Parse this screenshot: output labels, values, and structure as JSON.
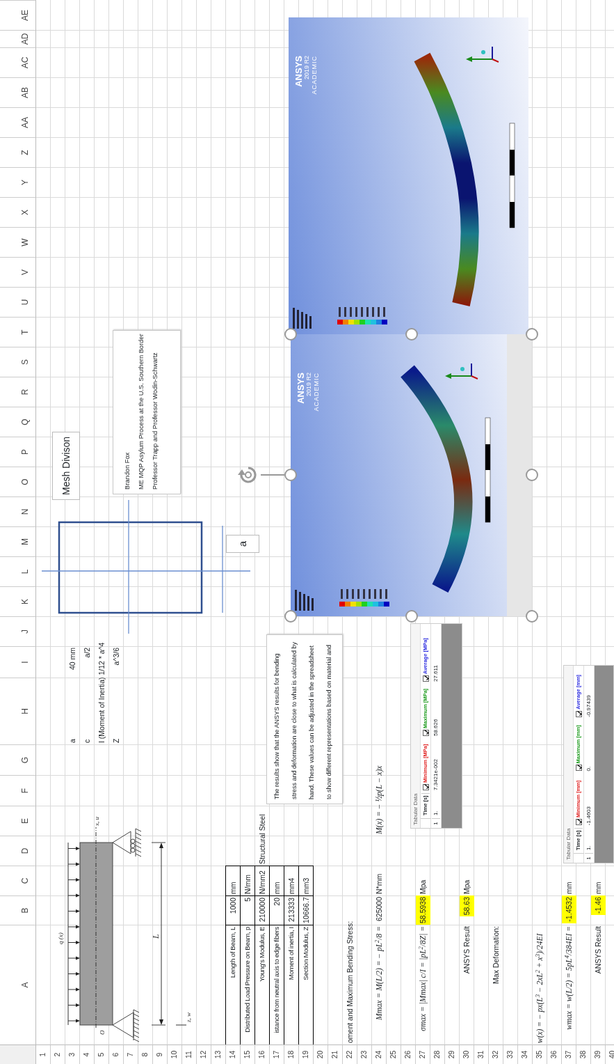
{
  "column_letters": [
    "A",
    "B",
    "C",
    "D",
    "E",
    "F",
    "G",
    "H",
    "I",
    "J",
    "K",
    "L",
    "M",
    "N",
    "O",
    "P",
    "Q",
    "R",
    "S",
    "T",
    "U",
    "V",
    "W",
    "X",
    "Y",
    "Z",
    "AA",
    "AB",
    "AC",
    "AD",
    "AE"
  ],
  "rows": [
    {
      "number": "1"
    },
    {
      "number": "2"
    },
    {
      "number": "3",
      "cells": [
        null,
        null,
        null,
        null,
        null,
        null,
        null,
        {
          "kind": "text",
          "text": "a"
        },
        {
          "kind": "value",
          "text": "40 mm",
          "highlighted": false
        }
      ]
    },
    {
      "number": "4",
      "cells": [
        null,
        null,
        null,
        null,
        null,
        null,
        null,
        {
          "kind": "text",
          "text": "c"
        },
        {
          "kind": "value",
          "text": "a/2",
          "highlighted": false
        }
      ]
    },
    {
      "number": "5",
      "cells": [
        null,
        null,
        null,
        null,
        null,
        null,
        null,
        {
          "kind": "text",
          "text": "I (Moment of Inertia) 1/12 * a^4"
        }
      ]
    },
    {
      "number": "6",
      "cells": [
        null,
        null,
        null,
        null,
        null,
        null,
        null,
        {
          "kind": "text",
          "text": "Z"
        },
        {
          "kind": "value",
          "text": "a^3/6",
          "highlighted": false
        }
      ]
    },
    {
      "number": "7"
    },
    {
      "number": "8"
    },
    {
      "number": "9"
    },
    {
      "number": "10"
    },
    {
      "number": "11"
    },
    {
      "number": "12"
    },
    {
      "number": "13"
    },
    {
      "number": "14",
      "cells": [
        {
          "kind": "table-label",
          "text": "Length of Beam, L"
        },
        {
          "kind": "table-value",
          "text": "1000"
        },
        {
          "kind": "table-unit",
          "text": "mm"
        }
      ]
    },
    {
      "number": "15",
      "cells": [
        {
          "kind": "table-label",
          "text": "Distributed Load Pressure on Beam, p"
        },
        {
          "kind": "table-value",
          "text": "5"
        },
        {
          "kind": "table-unit",
          "text": "N/mm"
        }
      ]
    },
    {
      "number": "16",
      "cells": [
        {
          "kind": "table-label",
          "text": "Young's Modulus, E"
        },
        {
          "kind": "table-value",
          "text": "210000"
        },
        {
          "kind": "table-unit",
          "text": "N/mm2"
        },
        {
          "kind": "text",
          "text": "Structural Steel"
        }
      ]
    },
    {
      "number": "17",
      "cells": [
        {
          "kind": "table-label",
          "text": "istance from neutral axis to edge fibers"
        },
        {
          "kind": "table-value",
          "text": "20"
        },
        {
          "kind": "table-unit",
          "text": "mm"
        }
      ]
    },
    {
      "number": "18",
      "cells": [
        {
          "kind": "table-label",
          "text": "Moment of inertia, I"
        },
        {
          "kind": "table-value",
          "text": "213333"
        },
        {
          "kind": "table-unit",
          "text": "mm4"
        }
      ]
    },
    {
      "number": "19",
      "cells": [
        {
          "kind": "table-label",
          "text": "Section Modulus, Z"
        },
        {
          "kind": "table-value",
          "text": "10666.7"
        },
        {
          "kind": "table-unit",
          "text": "mm3"
        }
      ]
    },
    {
      "number": "20"
    },
    {
      "number": "21"
    },
    {
      "number": "22",
      "cells": [
        {
          "kind": "text",
          "text": "oment and Maximum Bending Stress:"
        }
      ]
    },
    {
      "number": "23"
    },
    {
      "number": "24",
      "cells": [
        {
          "kind": "formula",
          "text": "Mmax = M(L/2) = − pL$^{2}$/8 ="
        },
        {
          "kind": "value",
          "text": "625000",
          "highlighted": false
        },
        {
          "kind": "text",
          "text": "N*mm"
        },
        null,
        {
          "kind": "note-formula",
          "text": "M(x) = − ½p(L − x)x"
        }
      ]
    },
    {
      "number": "25"
    },
    {
      "number": "26"
    },
    {
      "number": "27",
      "cells": [
        {
          "kind": "formula",
          "text": "σmax = |Mmax| c/I = |pL$^{2}$/8Z| ="
        },
        {
          "kind": "value",
          "text": "58.5938",
          "highlighted": true
        },
        {
          "kind": "text",
          "text": "Mpa"
        }
      ]
    },
    {
      "number": "28"
    },
    {
      "number": "29"
    },
    {
      "number": "30",
      "cells": [
        {
          "kind": "label",
          "text": "ANSYS Result"
        },
        {
          "kind": "value",
          "text": "58.63",
          "highlighted": true
        },
        {
          "kind": "text",
          "text": "Mpa"
        }
      ]
    },
    {
      "number": "31"
    },
    {
      "number": "32",
      "cells": [
        {
          "kind": "label",
          "text": "Max Deformation:"
        }
      ]
    },
    {
      "number": "33"
    },
    {
      "number": "34"
    },
    {
      "number": "35",
      "cells": [
        {
          "kind": "note-formula",
          "text": "w(x) = − px(L$^{3}$ − 2xL$^{2}$ + x$^{3}$)/24EI"
        }
      ]
    },
    {
      "number": "36"
    },
    {
      "number": "37",
      "cells": [
        {
          "kind": "formula",
          "text": "wmax = w(L/2) = 5pL$^{4}$/384EI ="
        },
        {
          "kind": "value",
          "text": "-1.4532",
          "highlighted": true
        },
        {
          "kind": "text",
          "text": "mm"
        }
      ]
    },
    {
      "number": "38"
    },
    {
      "number": "39",
      "cells": [
        {
          "kind": "label",
          "text": "ANSYS Result"
        },
        {
          "kind": "value",
          "text": "-1.46",
          "highlighted": true
        },
        {
          "kind": "text",
          "text": "mm"
        }
      ]
    },
    {
      "number": "40"
    }
  ],
  "beam_diagram": {
    "labels": [
      "q (x)",
      "O",
      "x, u",
      "L",
      "z, w"
    ]
  },
  "cross_section": {
    "label": "a"
  },
  "mesh_label": "Mesh Divison",
  "author_box": {
    "lines": [
      "Brandon Fox",
      "ME MQP Asylum Process at the U.S. Southern Border",
      "Professor Trapp and Professor Wodin-Schwartz"
    ]
  },
  "results_note": "The results show that the ANSYS results for bending stress and deformation are close to what is calculated by hand. These values can be adjusted in the spreadsheet to show different representations based on material and",
  "images": [
    {
      "kind": "stress",
      "logo": "ANSYS",
      "version": "2019 R2",
      "edition": "ACADEMIC",
      "selected": true
    },
    {
      "kind": "deformation",
      "logo": "ANSYS",
      "version": "2019 R2",
      "edition": "ACADEMIC",
      "selected": false
    }
  ],
  "tabular_panels": [
    {
      "title": "Tabular Data",
      "record_index": "1",
      "fields": [
        {
          "label": "Time [s]",
          "kind": "plain",
          "value": "1."
        },
        {
          "label": "Minimum [MPa]",
          "kind": "check",
          "checked": true,
          "color": "#e02020",
          "value": "7.3421e-002"
        },
        {
          "label": "Maximum [MPa]",
          "kind": "check",
          "checked": true,
          "color": "#1a9a1a",
          "value": "58.626"
        },
        {
          "label": "Average [MPa]",
          "kind": "check",
          "checked": true,
          "color": "#2a2ae0",
          "value": "27.611"
        }
      ]
    },
    {
      "title": "Tabular Data",
      "record_index": "1",
      "fields": [
        {
          "label": "Time [s]",
          "kind": "plain",
          "value": "1."
        },
        {
          "label": "Minimum [mm]",
          "kind": "check",
          "checked": true,
          "color": "#e02020",
          "value": "-1.4603"
        },
        {
          "label": "Maximum [mm]",
          "kind": "check",
          "checked": true,
          "color": "#1a9a1a",
          "value": "0."
        },
        {
          "label": "Average [mm]",
          "kind": "check",
          "checked": true,
          "color": "#2a2ae0",
          "value": "-0.97439"
        }
      ]
    }
  ]
}
